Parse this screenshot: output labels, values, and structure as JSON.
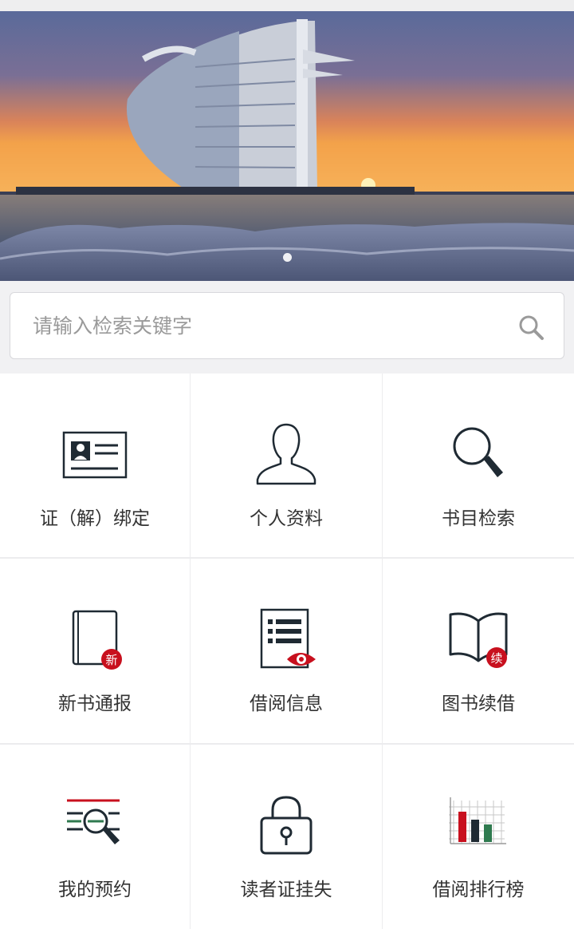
{
  "banner": {
    "slide_count": 1,
    "active_slide": 1
  },
  "search": {
    "placeholder": "请输入检索关键字",
    "value": ""
  },
  "menu": {
    "items": [
      {
        "label": "证（解）绑定",
        "icon": "id-card-icon"
      },
      {
        "label": "个人资料",
        "icon": "person-icon"
      },
      {
        "label": "书目检索",
        "icon": "magnifier-icon"
      },
      {
        "label": "新书通报",
        "icon": "new-book-icon",
        "badge": "新"
      },
      {
        "label": "借阅信息",
        "icon": "list-eye-icon"
      },
      {
        "label": "图书续借",
        "icon": "open-book-icon",
        "badge": "续"
      },
      {
        "label": "我的预约",
        "icon": "reservation-search-icon"
      },
      {
        "label": "读者证挂失",
        "icon": "padlock-icon"
      },
      {
        "label": "借阅排行榜",
        "icon": "bar-chart-icon"
      }
    ]
  },
  "colors": {
    "accent_red": "#c8101e",
    "icon_dark": "#1f2a33",
    "icon_green": "#2f7a4f"
  }
}
